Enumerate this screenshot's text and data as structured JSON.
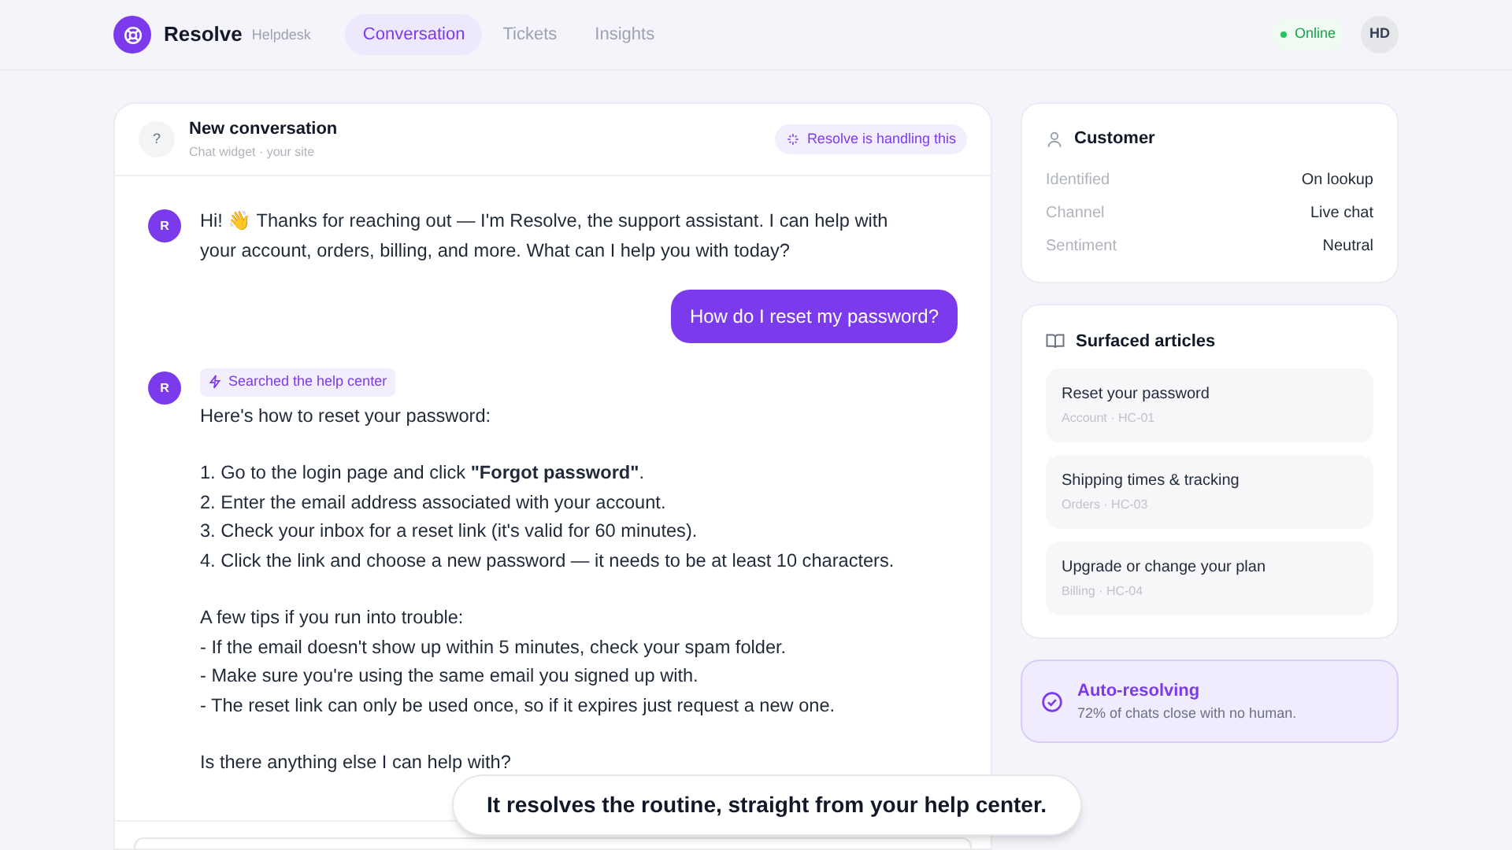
{
  "brand": {
    "name": "Resolve",
    "subtitle": "Helpdesk"
  },
  "nav": [
    {
      "label": "Conversation",
      "selected": true
    },
    {
      "label": "Tickets",
      "selected": false
    },
    {
      "label": "Insights",
      "selected": false
    }
  ],
  "status": {
    "label": "Online",
    "color": "#22c55e"
  },
  "user": {
    "initials": "HD"
  },
  "conversation": {
    "avatar": "?",
    "title": "New conversation",
    "subtitle": "Chat widget · your site",
    "badge": "Resolve is handling this",
    "messages": [
      {
        "kind": "bot",
        "avatar": "R",
        "paragraphs": [
          [
            "Hi! 👋  Thanks for reaching out — I'm Resolve, the support assistant. I can help with your account, orders, billing, and more. What can I help you with today?"
          ]
        ]
      },
      {
        "kind": "user",
        "text": "How do I reset my password?"
      },
      {
        "kind": "bot",
        "avatar": "R",
        "tag": "Searched the help center",
        "paragraphs": [
          [
            "Here's how to reset your password:"
          ],
          [
            "1. Go to the login page and click **\"Forgot password\"**.",
            "2. Enter the email address associated with your account.",
            "3. Check your inbox for a reset link (it's valid for 60 minutes).",
            "4. Click the link and choose a new password — it needs to be at least 10 characters."
          ],
          [
            "A few tips if you run into trouble:",
            "- If the email doesn't show up within 5 minutes, check your spam folder.",
            "- Make sure you're using the same email you signed up with.",
            "- The reset link can only be used once, so if it expires just request a new one."
          ],
          [
            "Is there anything else I can help with?"
          ]
        ]
      }
    ]
  },
  "customer": {
    "title": "Customer",
    "rows": [
      {
        "label": "Identified",
        "value": "On lookup"
      },
      {
        "label": "Channel",
        "value": "Live chat"
      },
      {
        "label": "Sentiment",
        "value": "Neutral"
      }
    ]
  },
  "articles": {
    "title": "Surfaced articles",
    "items": [
      {
        "title": "Reset your password",
        "meta": "Account · HC-01"
      },
      {
        "title": "Shipping times & tracking",
        "meta": "Orders · HC-03"
      },
      {
        "title": "Upgrade or change your plan",
        "meta": "Billing · HC-04"
      }
    ]
  },
  "auto": {
    "title": "Auto-resolving",
    "text": "72% of chats close with no human."
  },
  "caption": "It resolves the routine, straight from your help center."
}
